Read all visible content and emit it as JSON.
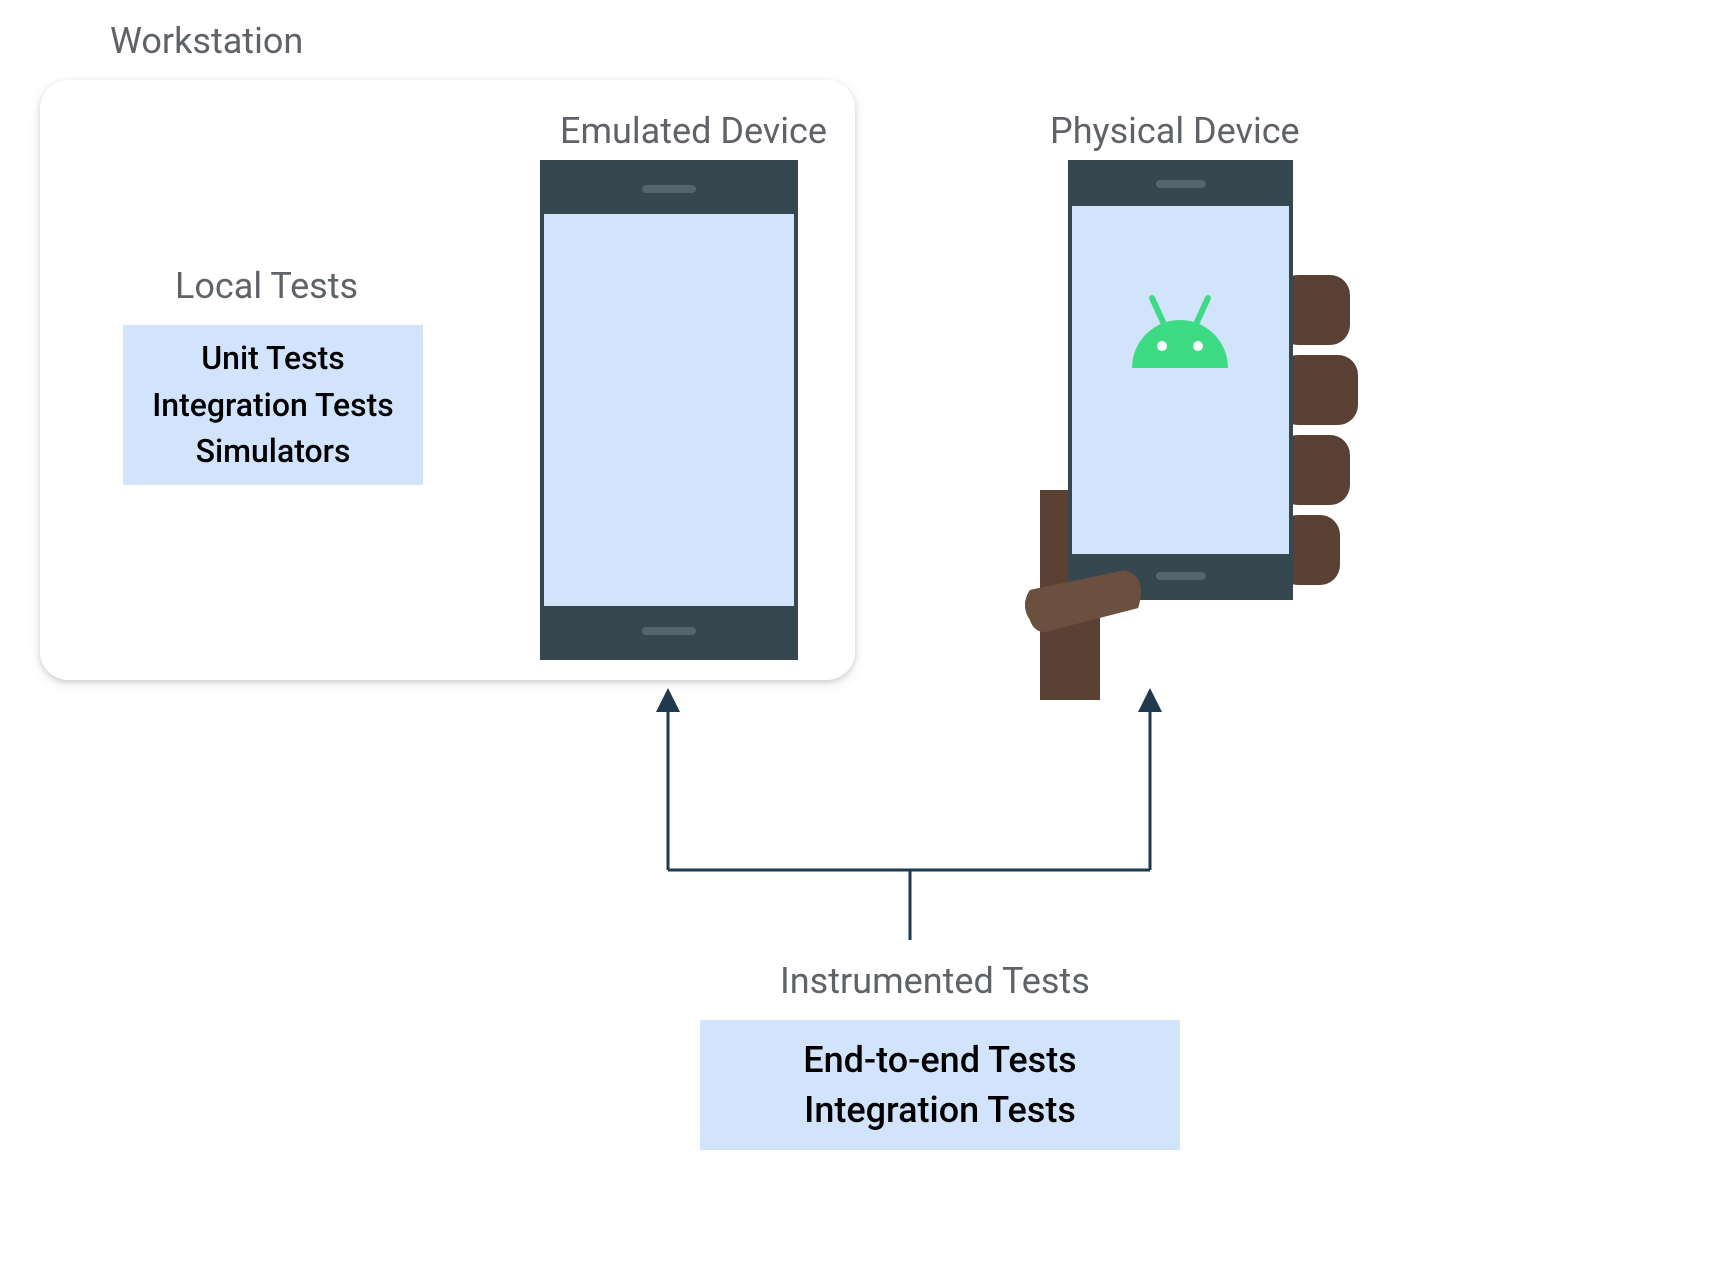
{
  "labels": {
    "workstation": "Workstation",
    "localTests": "Local Tests",
    "emulatedDevice": "Emulated Device",
    "physicalDevice": "Physical Device",
    "instrumentedTests": "Instrumented Tests"
  },
  "localTestsBox": {
    "line1": "Unit Tests",
    "line2": "Integration Tests",
    "line3": "Simulators"
  },
  "instrumentedBox": {
    "line1": "End-to-end Tests",
    "line2": "Integration Tests"
  },
  "colors": {
    "label": "#5f6368",
    "boxBg": "#D2E3FC",
    "phoneFrame": "#37474F",
    "handDark": "#5a4133",
    "handLight": "#6b4f3f",
    "androidGreen": "#3DDC84",
    "connector": "#1f3a4d"
  }
}
